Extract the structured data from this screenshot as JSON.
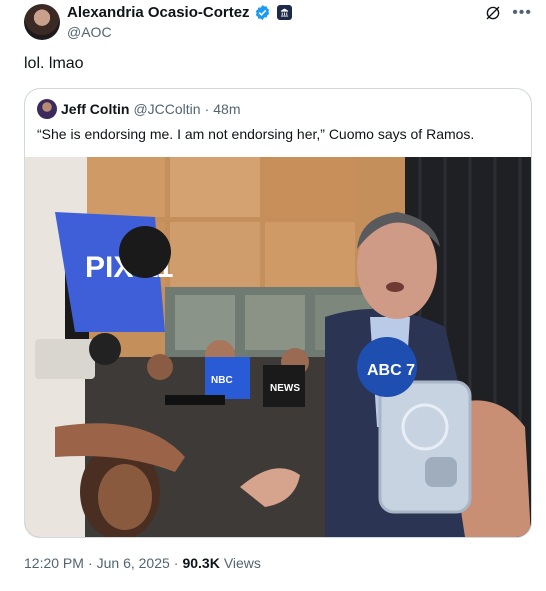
{
  "author": {
    "name": "Alexandria Ocasio-Cortez",
    "handle": "@AOC"
  },
  "tweet": {
    "text": "lol. lmao"
  },
  "quoted": {
    "name": "Jeff Coltin",
    "handle": "@JCColtin",
    "separator": "·",
    "age": "48m",
    "text": "“She is endorsing me. I am not endorsing her,” Cuomo says of Ramos.",
    "photo": {
      "microphone_logos": [
        "PIX 11",
        "NBC",
        "ABC 7",
        "NEWS"
      ]
    }
  },
  "meta": {
    "time": "12:20 PM",
    "dot1": "·",
    "date": "Jun 6, 2025",
    "dot2": "·",
    "views_count": "90.3K",
    "views_label": "Views"
  },
  "colors": {
    "verified": "#1d9bf0",
    "muted": "#536471",
    "border": "#cfd9de"
  },
  "icons": [
    "verified-badge-icon",
    "gov-badge-icon",
    "grok-icon",
    "more-icon"
  ]
}
